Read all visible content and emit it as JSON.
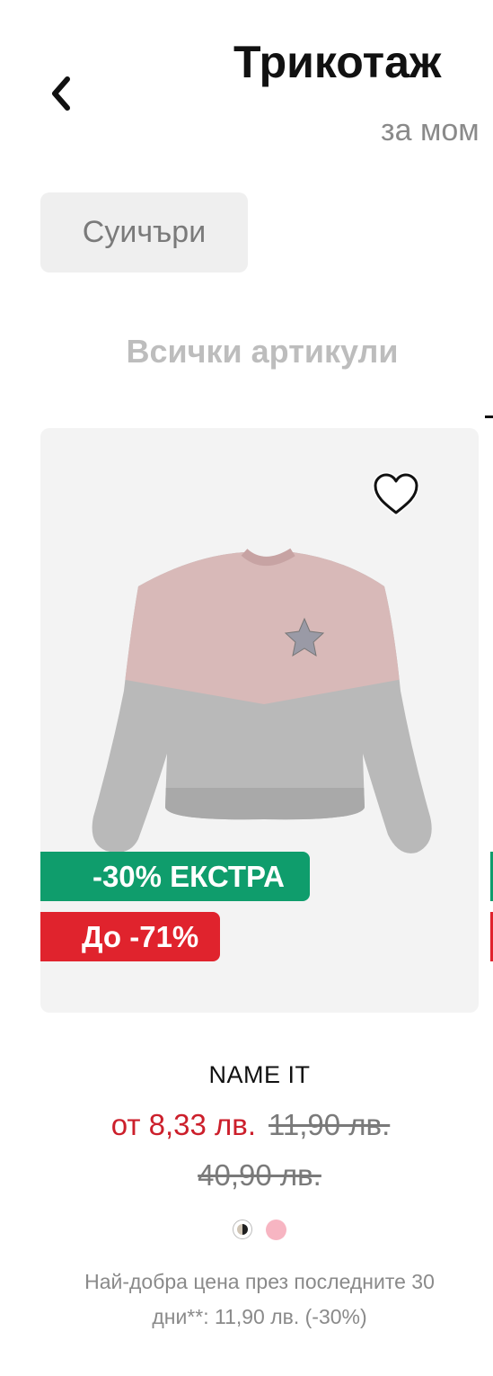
{
  "header": {
    "title": "Трикотаж",
    "subtitle": "за мом",
    "back_icon": "chevron-left-icon"
  },
  "filters": {
    "chips": [
      {
        "label": "Суичъри"
      }
    ]
  },
  "tabs": [
    {
      "label": "Всички артикули",
      "active": true
    }
  ],
  "product": {
    "brand": "NAME IT",
    "badges": [
      {
        "label": "-30% ЕКСТРА",
        "color": "#0f9d6c"
      },
      {
        "label": "До -71%",
        "color": "#e0232d"
      }
    ],
    "price_now": "от 8,33 лв.",
    "price_old_1": "11,90 лв.",
    "price_old_2": "40,90 лв.",
    "colors": [
      "#cfc4b4",
      "#f7b5c2"
    ],
    "best_price_note": "Най-добра цена през последните 30 дни**: 11,90 лв. (-30%)",
    "wishlist_icon": "heart-outline-icon"
  },
  "colors": {
    "sale_red": "#cc1f2b",
    "extra_green": "#0f9d6c",
    "card_bg": "#f3f3f3"
  }
}
